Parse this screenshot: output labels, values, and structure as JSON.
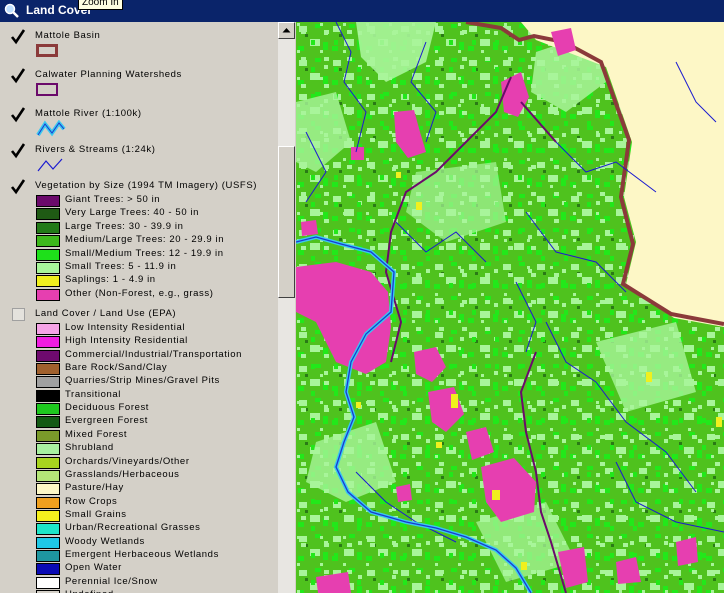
{
  "window": {
    "title": "Land Cover",
    "tooltip": "Zoom In"
  },
  "colors": {
    "titlebar": "#0a246a",
    "forest": "#4fc21e",
    "light_forest": "#a8f59a",
    "grass": "#e63fb0",
    "river": "#2828ff",
    "mattole_river": "#3ac8f0",
    "basin": "#8b3a3a",
    "ocean": "#fdf7c6"
  },
  "legend": {
    "layers": [
      {
        "name": "Mattole Basin",
        "checked": true,
        "symbol": "basin-outline"
      },
      {
        "name": "Calwater Planning Watersheds",
        "checked": true,
        "symbol": "watershed-outline"
      },
      {
        "name": "Mattole River (1:100k)",
        "checked": true,
        "symbol": "river-line"
      },
      {
        "name": "Rivers & Streams (1:24k)",
        "checked": true,
        "symbol": "stream-line"
      },
      {
        "name": "Vegetation by Size (1994 TM Imagery) (USFS)",
        "checked": true,
        "classes": [
          {
            "label": "Giant Trees: > 50 in",
            "color": "#6b0a6b"
          },
          {
            "label": "Very Large Trees: 40 - 50 in",
            "color": "#1f5a14"
          },
          {
            "label": "Large Trees: 30 - 39.9 in",
            "color": "#227a18"
          },
          {
            "label": "Medium/Large Trees: 20 - 29.9 in",
            "color": "#3db81c"
          },
          {
            "label": "Small/Medium Trees: 12 - 19.9 in",
            "color": "#1ee01a"
          },
          {
            "label": "Small Trees: 5 - 11.9 in",
            "color": "#a8f59a"
          },
          {
            "label": "Saplings: 1 - 4.9 in",
            "color": "#f0f01e"
          },
          {
            "label": "Other (Non-Forest, e.g., grass)",
            "color": "#e63fb0"
          }
        ]
      },
      {
        "name": "Land Cover / Land Use (EPA)",
        "checked": false,
        "classes": [
          {
            "label": "Low Intensity Residential",
            "color": "#f5a3e6"
          },
          {
            "label": "High Intensity Residential",
            "color": "#f01ee0"
          },
          {
            "label": "Commercial/Industrial/Transportation",
            "color": "#6e0a6e"
          },
          {
            "label": "Bare Rock/Sand/Clay",
            "color": "#a0602d"
          },
          {
            "label": "Quarries/Strip Mines/Gravel Pits",
            "color": "#a0a0a0"
          },
          {
            "label": "Transitional",
            "color": "#000000"
          },
          {
            "label": "Deciduous Forest",
            "color": "#1ec81e"
          },
          {
            "label": "Evergreen Forest",
            "color": "#145a14"
          },
          {
            "label": "Mixed Forest",
            "color": "#7a9a2a"
          },
          {
            "label": "Shrubland",
            "color": "#a8f0a0"
          },
          {
            "label": "Orchards/Vineyards/Other",
            "color": "#a8d41e"
          },
          {
            "label": "Grasslands/Herbaceous",
            "color": "#b4e678"
          },
          {
            "label": "Pasture/Hay",
            "color": "#fdf7c6"
          },
          {
            "label": "Row Crops",
            "color": "#f0a01e"
          },
          {
            "label": "Small Grains",
            "color": "#f5f01e"
          },
          {
            "label": "Urban/Recreational Grasses",
            "color": "#1ee6c8"
          },
          {
            "label": "Woody Wetlands",
            "color": "#1ec8e6"
          },
          {
            "label": "Emergent Herbaceous Wetlands",
            "color": "#1e96a0"
          },
          {
            "label": "Open Water",
            "color": "#0a0ab4"
          },
          {
            "label": "Perennial Ice/Snow",
            "color": "#ffffff"
          },
          {
            "label": "Undefined",
            "color": "#d4d0c8"
          }
        ]
      }
    ]
  }
}
